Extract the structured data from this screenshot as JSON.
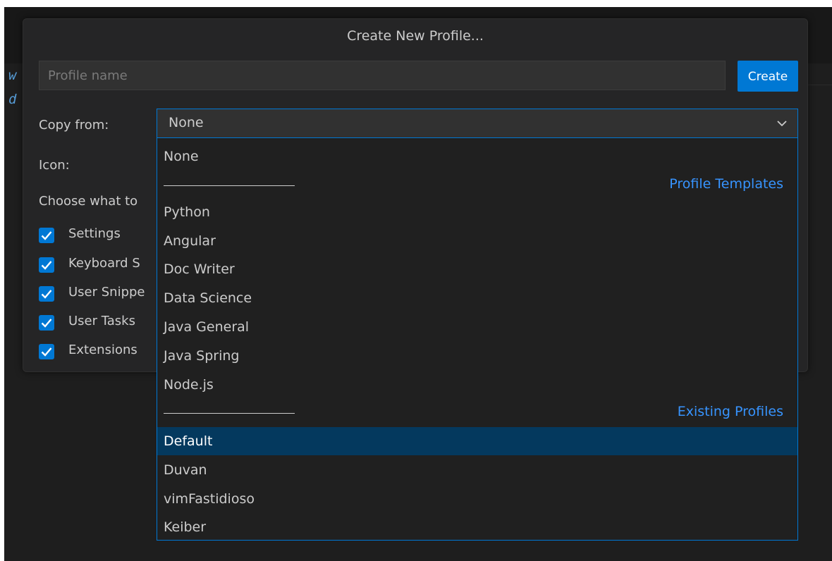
{
  "background": {
    "code_lines": [
      "w",
      "d"
    ]
  },
  "dialog": {
    "title": "Create New Profile...",
    "name_input": {
      "value": "",
      "placeholder": "Profile name"
    },
    "create_label": "Create",
    "copy_from_label": "Copy from:",
    "icon_label": "Icon:",
    "choose_label": "Choose what to",
    "checks": [
      {
        "label": "Settings",
        "checked": true
      },
      {
        "label": "Keyboard S",
        "checked": true
      },
      {
        "label": "User Snippe",
        "checked": true
      },
      {
        "label": "User Tasks",
        "checked": true
      },
      {
        "label": "Extensions",
        "checked": true
      }
    ]
  },
  "select": {
    "value": "None"
  },
  "dropdown": {
    "none_option": "None",
    "sep1_title": "Profile Templates",
    "templates": [
      "Python",
      "Angular",
      "Doc Writer",
      "Data Science",
      "Java General",
      "Java Spring",
      "Node.js"
    ],
    "sep2_title": "Existing Profiles",
    "profiles": [
      "Default",
      "Duvan",
      "vimFastidioso",
      "Keiber"
    ],
    "selected": "Default"
  },
  "colors": {
    "accent": "#0078d4",
    "selection": "#04395e",
    "separator_title": "#3794ff",
    "dialog_bg": "#252526"
  }
}
